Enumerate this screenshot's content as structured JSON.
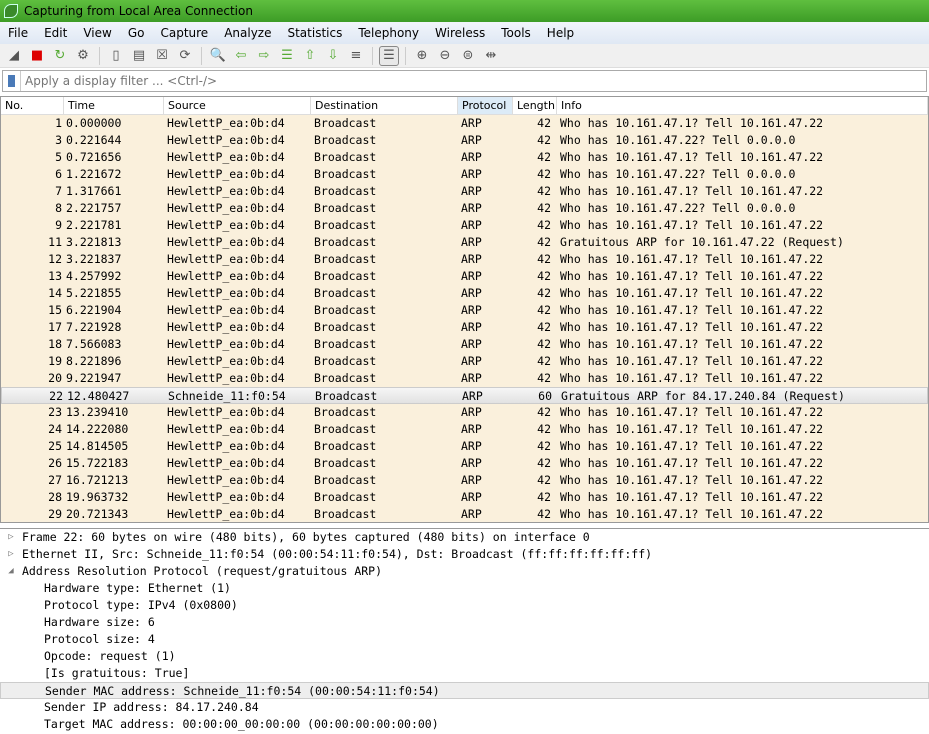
{
  "window": {
    "title": "Capturing from Local Area Connection"
  },
  "menu": [
    "File",
    "Edit",
    "View",
    "Go",
    "Capture",
    "Analyze",
    "Statistics",
    "Telephony",
    "Wireless",
    "Tools",
    "Help"
  ],
  "toolbar": [
    "shark-fin-start-icon",
    "stop-capture-icon",
    "restart-capture-icon",
    "capture-options-icon",
    "sep",
    "open-file-icon",
    "save-file-icon",
    "close-file-icon",
    "reload-file-icon",
    "sep",
    "find-packet-icon",
    "go-back-icon",
    "go-forward-icon",
    "go-to-packet-icon",
    "first-packet-icon",
    "last-packet-icon",
    "autoscroll-icon",
    "sep",
    "colorize-icon",
    "sep",
    "zoom-in-icon",
    "zoom-out-icon",
    "zoom-normal-icon",
    "resize-columns-icon"
  ],
  "filter": {
    "placeholder": "Apply a display filter ... <Ctrl-/>"
  },
  "columns": [
    "No.",
    "Time",
    "Source",
    "Destination",
    "Protocol",
    "Length",
    "Info"
  ],
  "colors": {
    "arp_row": "#faf0dc",
    "title_green": "#4caf33"
  },
  "packets": [
    [
      "1",
      "0.000000",
      "HewlettP_ea:0b:d4",
      "Broadcast",
      "ARP",
      "42",
      "Who has 10.161.47.1? Tell 10.161.47.22"
    ],
    [
      "3",
      "0.221644",
      "HewlettP_ea:0b:d4",
      "Broadcast",
      "ARP",
      "42",
      "Who has 10.161.47.22? Tell 0.0.0.0"
    ],
    [
      "5",
      "0.721656",
      "HewlettP_ea:0b:d4",
      "Broadcast",
      "ARP",
      "42",
      "Who has 10.161.47.1? Tell 10.161.47.22"
    ],
    [
      "6",
      "1.221672",
      "HewlettP_ea:0b:d4",
      "Broadcast",
      "ARP",
      "42",
      "Who has 10.161.47.22? Tell 0.0.0.0"
    ],
    [
      "7",
      "1.317661",
      "HewlettP_ea:0b:d4",
      "Broadcast",
      "ARP",
      "42",
      "Who has 10.161.47.1? Tell 10.161.47.22"
    ],
    [
      "8",
      "2.221757",
      "HewlettP_ea:0b:d4",
      "Broadcast",
      "ARP",
      "42",
      "Who has 10.161.47.22? Tell 0.0.0.0"
    ],
    [
      "9",
      "2.221781",
      "HewlettP_ea:0b:d4",
      "Broadcast",
      "ARP",
      "42",
      "Who has 10.161.47.1? Tell 10.161.47.22"
    ],
    [
      "11",
      "3.221813",
      "HewlettP_ea:0b:d4",
      "Broadcast",
      "ARP",
      "42",
      "Gratuitous ARP for 10.161.47.22 (Request)"
    ],
    [
      "12",
      "3.221837",
      "HewlettP_ea:0b:d4",
      "Broadcast",
      "ARP",
      "42",
      "Who has 10.161.47.1? Tell 10.161.47.22"
    ],
    [
      "13",
      "4.257992",
      "HewlettP_ea:0b:d4",
      "Broadcast",
      "ARP",
      "42",
      "Who has 10.161.47.1? Tell 10.161.47.22"
    ],
    [
      "14",
      "5.221855",
      "HewlettP_ea:0b:d4",
      "Broadcast",
      "ARP",
      "42",
      "Who has 10.161.47.1? Tell 10.161.47.22"
    ],
    [
      "15",
      "6.221904",
      "HewlettP_ea:0b:d4",
      "Broadcast",
      "ARP",
      "42",
      "Who has 10.161.47.1? Tell 10.161.47.22"
    ],
    [
      "17",
      "7.221928",
      "HewlettP_ea:0b:d4",
      "Broadcast",
      "ARP",
      "42",
      "Who has 10.161.47.1? Tell 10.161.47.22"
    ],
    [
      "18",
      "7.566083",
      "HewlettP_ea:0b:d4",
      "Broadcast",
      "ARP",
      "42",
      "Who has 10.161.47.1? Tell 10.161.47.22"
    ],
    [
      "19",
      "8.221896",
      "HewlettP_ea:0b:d4",
      "Broadcast",
      "ARP",
      "42",
      "Who has 10.161.47.1? Tell 10.161.47.22"
    ],
    [
      "20",
      "9.221947",
      "HewlettP_ea:0b:d4",
      "Broadcast",
      "ARP",
      "42",
      "Who has 10.161.47.1? Tell 10.161.47.22"
    ],
    [
      "22",
      "12.480427",
      "Schneide_11:f0:54",
      "Broadcast",
      "ARP",
      "60",
      "Gratuitous ARP for 84.17.240.84 (Request)"
    ],
    [
      "23",
      "13.239410",
      "HewlettP_ea:0b:d4",
      "Broadcast",
      "ARP",
      "42",
      "Who has 10.161.47.1? Tell 10.161.47.22"
    ],
    [
      "24",
      "14.222080",
      "HewlettP_ea:0b:d4",
      "Broadcast",
      "ARP",
      "42",
      "Who has 10.161.47.1? Tell 10.161.47.22"
    ],
    [
      "25",
      "14.814505",
      "HewlettP_ea:0b:d4",
      "Broadcast",
      "ARP",
      "42",
      "Who has 10.161.47.1? Tell 10.161.47.22"
    ],
    [
      "26",
      "15.722183",
      "HewlettP_ea:0b:d4",
      "Broadcast",
      "ARP",
      "42",
      "Who has 10.161.47.1? Tell 10.161.47.22"
    ],
    [
      "27",
      "16.721213",
      "HewlettP_ea:0b:d4",
      "Broadcast",
      "ARP",
      "42",
      "Who has 10.161.47.1? Tell 10.161.47.22"
    ],
    [
      "28",
      "19.963732",
      "HewlettP_ea:0b:d4",
      "Broadcast",
      "ARP",
      "42",
      "Who has 10.161.47.1? Tell 10.161.47.22"
    ],
    [
      "29",
      "20.721343",
      "HewlettP_ea:0b:d4",
      "Broadcast",
      "ARP",
      "42",
      "Who has 10.161.47.1? Tell 10.161.47.22"
    ]
  ],
  "selected_packet": "22",
  "details": [
    {
      "text": "Frame 22: 60 bytes on wire (480 bits), 60 bytes captured (480 bits) on interface 0",
      "level": 0,
      "state": "collapsed"
    },
    {
      "text": "Ethernet II, Src: Schneide_11:f0:54 (00:00:54:11:f0:54), Dst: Broadcast (ff:ff:ff:ff:ff:ff)",
      "level": 0,
      "state": "collapsed"
    },
    {
      "text": "Address Resolution Protocol (request/gratuitous ARP)",
      "level": 0,
      "state": "expanded"
    },
    {
      "text": "Hardware type: Ethernet (1)",
      "level": 1
    },
    {
      "text": "Protocol type: IPv4 (0x0800)",
      "level": 1
    },
    {
      "text": "Hardware size: 6",
      "level": 1
    },
    {
      "text": "Protocol size: 4",
      "level": 1
    },
    {
      "text": "Opcode: request (1)",
      "level": 1
    },
    {
      "text": "[Is gratuitous: True]",
      "level": 1
    },
    {
      "text": "Sender MAC address: Schneide_11:f0:54 (00:00:54:11:f0:54)",
      "level": 1,
      "highlighted": true
    },
    {
      "text": "Sender IP address: 84.17.240.84",
      "level": 1
    },
    {
      "text": "Target MAC address: 00:00:00_00:00:00 (00:00:00:00:00:00)",
      "level": 1
    }
  ]
}
